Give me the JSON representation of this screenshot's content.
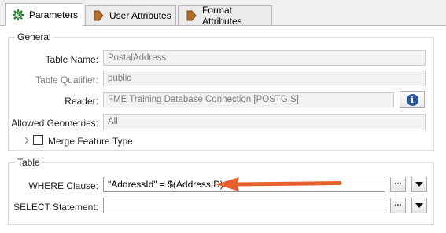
{
  "tabs": [
    {
      "label": "Parameters",
      "icon": "gear-icon",
      "active": true
    },
    {
      "label": "User Attributes",
      "icon": "attribute-icon",
      "active": false
    },
    {
      "label": "Format Attributes",
      "icon": "attribute-icon",
      "active": false
    }
  ],
  "general": {
    "title": "General",
    "table_name_label": "Table Name:",
    "table_name_value": "PostalAddress",
    "table_qualifier_label": "Table Qualifier:",
    "table_qualifier_value": "public",
    "reader_label": "Reader:",
    "reader_value": "FME Training Database Connection [POSTGIS]",
    "reader_info_icon": "i",
    "allowed_geometries_label": "Allowed Geometries:",
    "allowed_geometries_value": "All",
    "merge_feature_type_label": "Merge Feature Type",
    "merge_feature_type_checked": false
  },
  "table": {
    "title": "Table",
    "where_label": "WHERE Clause:",
    "where_value": "\"AddressId\" = $(AddressID)",
    "select_label": "SELECT Statement:",
    "select_value": "",
    "ellipsis_label": "..."
  },
  "colors": {
    "annotation_arrow": "#e8612c",
    "info_icon": "#2a5a9c",
    "attribute_icon": "#b0702a"
  }
}
